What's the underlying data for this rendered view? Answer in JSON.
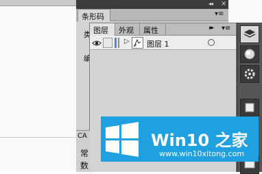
{
  "barcode_panel": {
    "title": "条形码",
    "collapse_icon": "double-chevron-left",
    "close_label": "×",
    "tab_label": "",
    "menu_icon": "▾≡",
    "char1": "类",
    "char2": "编"
  },
  "layers_panel": {
    "tabs": [
      {
        "label": "图层",
        "active": true
      },
      {
        "label": "外观",
        "active": false
      },
      {
        "label": "属性",
        "active": false
      }
    ],
    "collapse_icon": "▸▸",
    "menu_icon": "▾≡",
    "layer": {
      "name": "图层 1",
      "visible": true,
      "color": "#4f7fff",
      "expand_icon": "▷"
    }
  },
  "left_bottom_panel": {
    "tab_label": "CA",
    "char1": "常",
    "char2": "数"
  },
  "watermark": {
    "title": "Win10 之家",
    "url": "www.win10xitong.com"
  },
  "colors": {
    "dark_title": "#3c3c3c",
    "panel_bg": "#d9d9d9",
    "toolbar_bg": "#555555",
    "watermark_blue": "#1fa0e0"
  }
}
